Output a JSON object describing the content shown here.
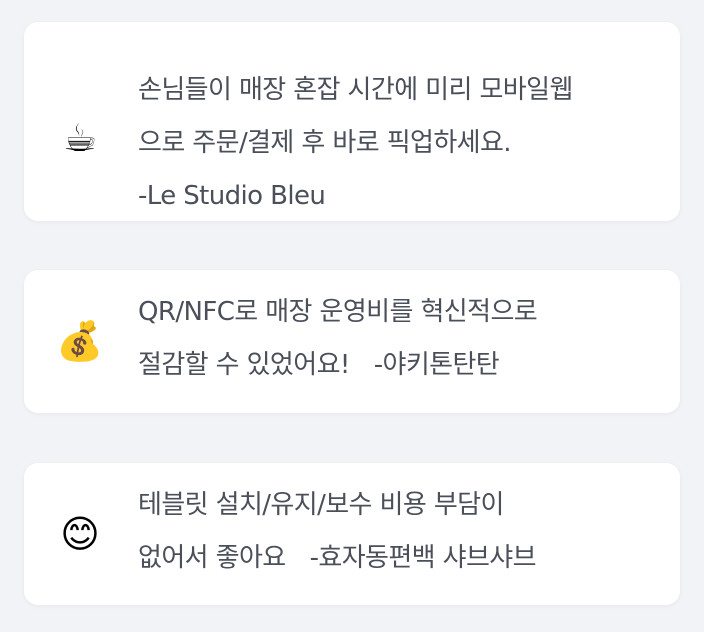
{
  "testimonials": [
    {
      "icon": "☕",
      "icon_name": "coffee-cup-icon",
      "line1": "손님들이 매장 혼잡 시간에 미리 모바일웹",
      "line2": "으로 주문/결제 후 바로 픽업하세요.",
      "author": "-Le Studio Bleu"
    },
    {
      "icon": "💰",
      "icon_name": "money-bag-icon",
      "line1": "QR/NFC로 매장 운영비를 혁신적으로",
      "line2": "절감할 수 있었어요!",
      "author": "-야키톤탄탄"
    },
    {
      "icon": "😊",
      "icon_name": "smiling-face-icon",
      "line1": "테블릿 설치/유지/보수 비용 부담이",
      "line2": "없어서 좋아요",
      "author": "-효자동편백 샤브샤브"
    }
  ]
}
